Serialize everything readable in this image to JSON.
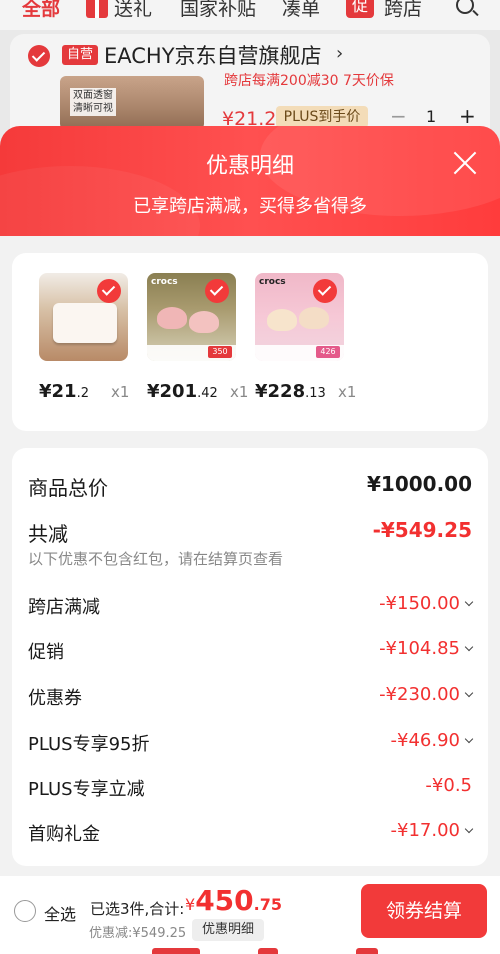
{
  "topnav": {
    "tabs": [
      "全部",
      "送礼",
      "国家补贴",
      "凑单",
      "跨店"
    ],
    "promo_badge": "促"
  },
  "store": {
    "self_badge": "自营",
    "name": "EACHY京东自营旗舰店",
    "arrow": "›",
    "product": {
      "image_text": "双面透窗\n清晰可视",
      "promo": "跨店每满200减30 7天价保",
      "price": "¥21.2",
      "plus_tag": "PLUS到手价",
      "minus": "−",
      "qty": "1",
      "plus": "+"
    }
  },
  "modal": {
    "title": "优惠明细",
    "subtitle": "已享跨店满减，买得多省得多",
    "products": [
      {
        "price_int": "¥21",
        "price_dec": ".2",
        "qty": "x1",
        "kind": "box"
      },
      {
        "price_int": "¥201",
        "price_dec": ".42",
        "qty": "x1",
        "kind": "crocs1",
        "badge": "350",
        "brand": "crocs"
      },
      {
        "price_int": "¥228",
        "price_dec": ".13",
        "qty": "x1",
        "kind": "crocs2",
        "badge": "426",
        "brand": "crocs"
      }
    ],
    "summary": {
      "total_label": "商品总价",
      "total_value": "¥1000.00",
      "reduce_label": "共减",
      "reduce_value": "-¥549.25",
      "note": "以下优惠不包含红包，请在结算页查看",
      "items": [
        {
          "label": "跨店满减",
          "value": "-¥150.00",
          "chevron": true
        },
        {
          "label": "促销",
          "value": "-¥104.85",
          "chevron": true
        },
        {
          "label": "优惠券",
          "value": "-¥230.00",
          "chevron": true
        },
        {
          "label": "PLUS专享95折",
          "value": "-¥46.90",
          "chevron": true
        },
        {
          "label": "PLUS专享立减",
          "value": "-¥0.5",
          "chevron": false
        },
        {
          "label": "首购礼金",
          "value": "-¥17.00",
          "chevron": true
        }
      ]
    }
  },
  "bottom_bar": {
    "select_all": "全选",
    "selected_info": "已选3件,合计:",
    "total_currency": "¥",
    "total_main": "450",
    "total_decimal": ".75",
    "discount_sum": "优惠减:¥549.25",
    "detail_button": "优惠明细",
    "checkout_button": "领券结算"
  },
  "colors": {
    "accent_red": "#f23030",
    "header_red": "#f53a3a"
  }
}
